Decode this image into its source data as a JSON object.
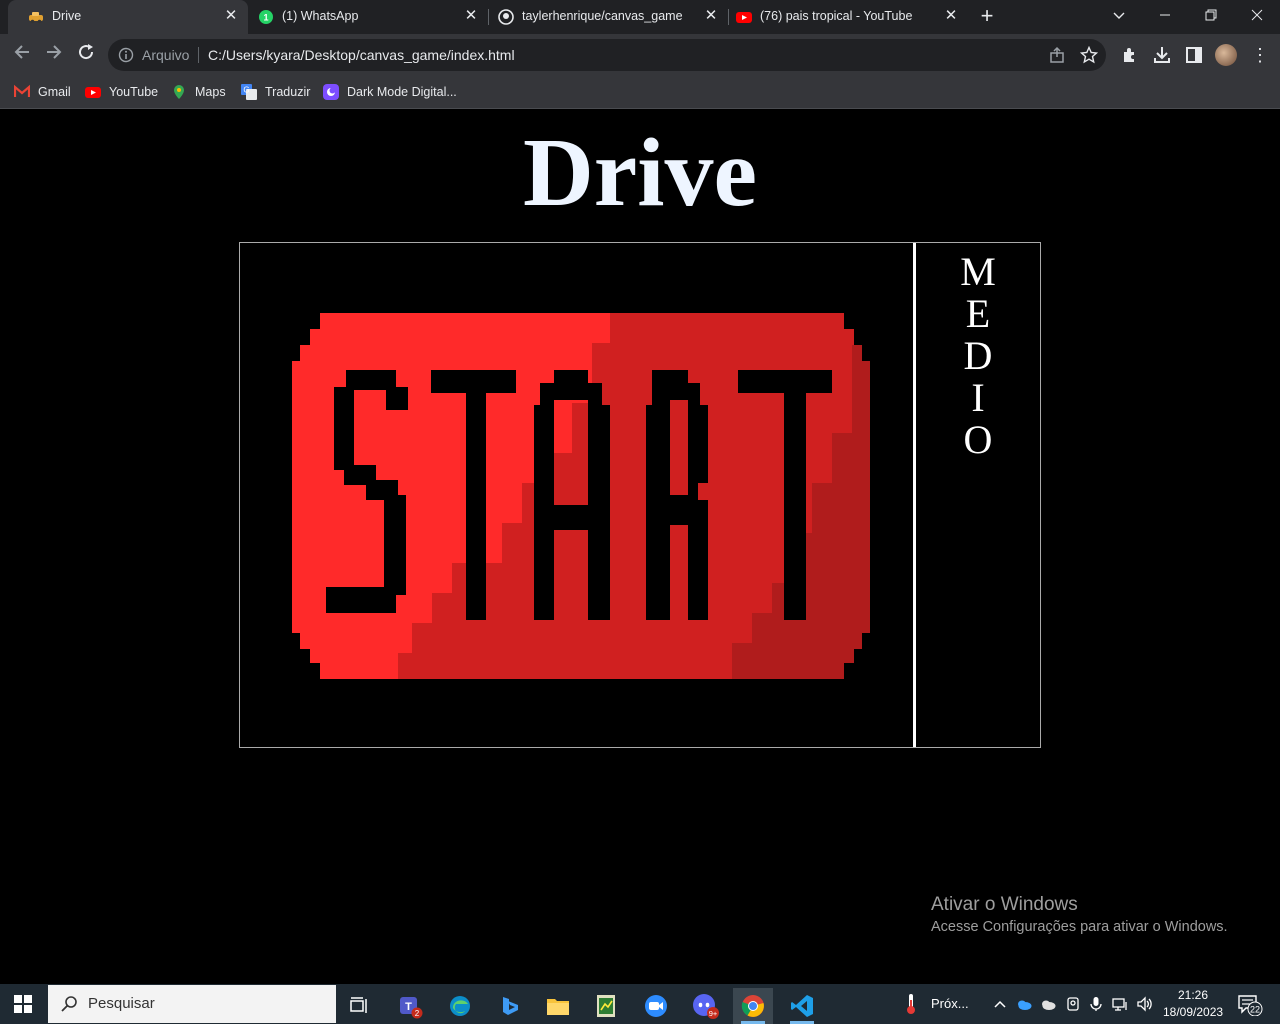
{
  "browser": {
    "tabs": [
      {
        "title": "Drive",
        "favicon": "game-car-icon",
        "active": true
      },
      {
        "title": "(1) WhatsApp",
        "favicon": "whatsapp-icon",
        "active": false
      },
      {
        "title": "taylerhenrique/canvas_game",
        "favicon": "github-icon",
        "active": false
      },
      {
        "title": "(76) pais tropical - YouTube",
        "favicon": "youtube-icon",
        "active": false
      }
    ],
    "address": {
      "scheme_label": "Arquivo",
      "url": "C:/Users/kyara/Desktop/canvas_game/index.html"
    },
    "bookmarks": [
      {
        "label": "Gmail",
        "icon": "gmail-icon"
      },
      {
        "label": "YouTube",
        "icon": "youtube-icon"
      },
      {
        "label": "Maps",
        "icon": "maps-icon"
      },
      {
        "label": "Traduzir",
        "icon": "translate-icon"
      },
      {
        "label": "Dark Mode Digital...",
        "icon": "dark-mode-icon"
      }
    ]
  },
  "game": {
    "title": "Drive",
    "start_button_text": "START",
    "difficulty_letters": [
      "M",
      "E",
      "D",
      "I",
      "O"
    ],
    "colors": {
      "button_light": "#ff2a2a",
      "button_mid": "#d02020",
      "button_dark": "#b01c1c",
      "text": "#000000"
    }
  },
  "watermark": {
    "title": "Ativar o Windows",
    "subtitle": "Acesse Configurações para ativar o Windows."
  },
  "taskbar": {
    "search_placeholder": "Pesquisar",
    "teams_badge": "2",
    "discord_badge": "9+",
    "weather_label": "Próx...",
    "time": "21:26",
    "date": "18/09/2023",
    "notifications_count": "22"
  }
}
